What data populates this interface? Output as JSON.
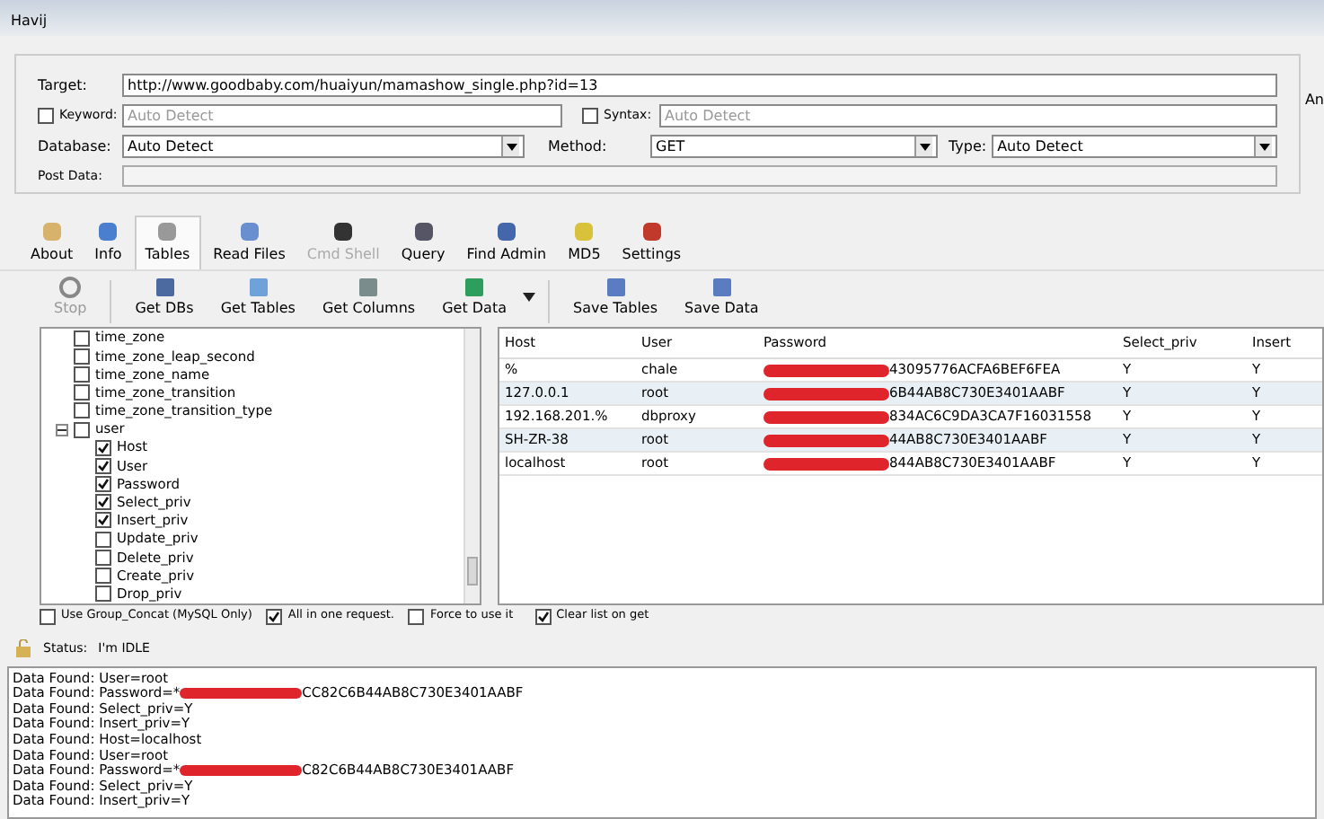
{
  "window": {
    "title": "Havij"
  },
  "form": {
    "target_label": "Target:",
    "target": "http://www.goodbaby.com/huaiyun/mamashow_single.php?id=13",
    "keyword": {
      "label": "Keyword:",
      "checked": false,
      "placeholder": "Auto Detect"
    },
    "syntax": {
      "label": "Syntax:",
      "checked": false,
      "placeholder": "Auto Detect"
    },
    "cut_label": "An",
    "database": {
      "label": "Database:",
      "value": "Auto Detect"
    },
    "method": {
      "label": "Method:",
      "value": "GET"
    },
    "type": {
      "label": "Type:",
      "value": "Auto Detect"
    },
    "post_data_label": "Post Data:"
  },
  "tabs": [
    {
      "label": "About",
      "selected": false,
      "disabled": false,
      "kind": "about"
    },
    {
      "label": "Info",
      "selected": false,
      "disabled": false,
      "kind": "info"
    },
    {
      "label": "Tables",
      "selected": true,
      "disabled": false,
      "kind": "tables"
    },
    {
      "label": "Read Files",
      "selected": false,
      "disabled": false,
      "kind": "file"
    },
    {
      "label": "Cmd Shell",
      "selected": false,
      "disabled": true,
      "kind": "shell"
    },
    {
      "label": "Query",
      "selected": false,
      "disabled": false,
      "kind": "query"
    },
    {
      "label": "Find Admin",
      "selected": false,
      "disabled": false,
      "kind": "admin"
    },
    {
      "label": "MD5",
      "selected": false,
      "disabled": false,
      "kind": "key"
    },
    {
      "label": "Settings",
      "selected": false,
      "disabled": false,
      "kind": "settings"
    }
  ],
  "actions": [
    {
      "label": "Stop",
      "disabled": true,
      "kind": "stop"
    },
    {
      "label": "Get DBs",
      "disabled": false,
      "kind": "db"
    },
    {
      "label": "Get Tables",
      "disabled": false,
      "kind": "table"
    },
    {
      "label": "Get Columns",
      "disabled": false,
      "kind": "columns"
    },
    {
      "label": "Get Data",
      "disabled": false,
      "kind": "data"
    },
    {
      "label": "Save Tables",
      "disabled": false,
      "kind": "save"
    },
    {
      "label": "Save Data",
      "disabled": false,
      "kind": "save"
    }
  ],
  "tree": [
    {
      "label": "time_zone",
      "checked": false
    },
    {
      "label": "time_zone_leap_second",
      "checked": false
    },
    {
      "label": "time_zone_name",
      "checked": false
    },
    {
      "label": "time_zone_transition",
      "checked": false
    },
    {
      "label": "time_zone_transition_type",
      "checked": false
    },
    {
      "label": "user",
      "checked": false,
      "expanded": true,
      "children": [
        {
          "label": "Host",
          "checked": true
        },
        {
          "label": "User",
          "checked": true
        },
        {
          "label": "Password",
          "checked": true
        },
        {
          "label": "Select_priv",
          "checked": true
        },
        {
          "label": "Insert_priv",
          "checked": true
        },
        {
          "label": "Update_priv",
          "checked": false
        },
        {
          "label": "Delete_priv",
          "checked": false
        },
        {
          "label": "Create_priv",
          "checked": false
        },
        {
          "label": "Drop_priv",
          "checked": false
        }
      ]
    }
  ],
  "options": [
    {
      "label": "Use Group_Concat (MySQL Only)",
      "checked": false
    },
    {
      "label": "All in one request.",
      "checked": true
    },
    {
      "label": "Force to use it",
      "checked": false
    },
    {
      "label": "Clear list on get",
      "checked": true
    }
  ],
  "table": {
    "columns": [
      "Host",
      "User",
      "Password",
      "Select_priv",
      "Insert"
    ],
    "rows": [
      [
        "%",
        "chale",
        "43095776ACFA6BEF6FEA",
        "Y",
        "Y"
      ],
      [
        "127.0.0.1",
        "root",
        "6B44AB8C730E3401AABF",
        "Y",
        "Y"
      ],
      [
        "192.168.201.%",
        "dbproxy",
        "834AC6C9DA3CA7F16031558",
        "Y",
        "Y"
      ],
      [
        "SH-ZR-38",
        "root",
        "44AB8C730E3401AABF",
        "Y",
        "Y"
      ],
      [
        "localhost",
        "root",
        "844AB8C730E3401AABF",
        "Y",
        "Y"
      ]
    ]
  },
  "status": {
    "label": "Status:",
    "value": "I'm IDLE"
  },
  "log": [
    {
      "text": "Data Found: User=root",
      "redacted": false
    },
    {
      "text": "Data Found: Password=*",
      "redacted": true,
      "tail": "CC82C6B44AB8C730E3401AABF"
    },
    {
      "text": "Data Found: Select_priv=Y",
      "redacted": false
    },
    {
      "text": "Data Found: Insert_priv=Y",
      "redacted": false
    },
    {
      "text": "Data Found: Host=localhost",
      "redacted": false
    },
    {
      "text": "Data Found: User=root",
      "redacted": false
    },
    {
      "text": "Data Found: Password=*",
      "redacted": true,
      "tail": "C82C6B44AB8C730E3401AABF"
    },
    {
      "text": "Data Found: Select_priv=Y",
      "redacted": false
    },
    {
      "text": "Data Found: Insert_priv=Y",
      "redacted": false
    }
  ]
}
